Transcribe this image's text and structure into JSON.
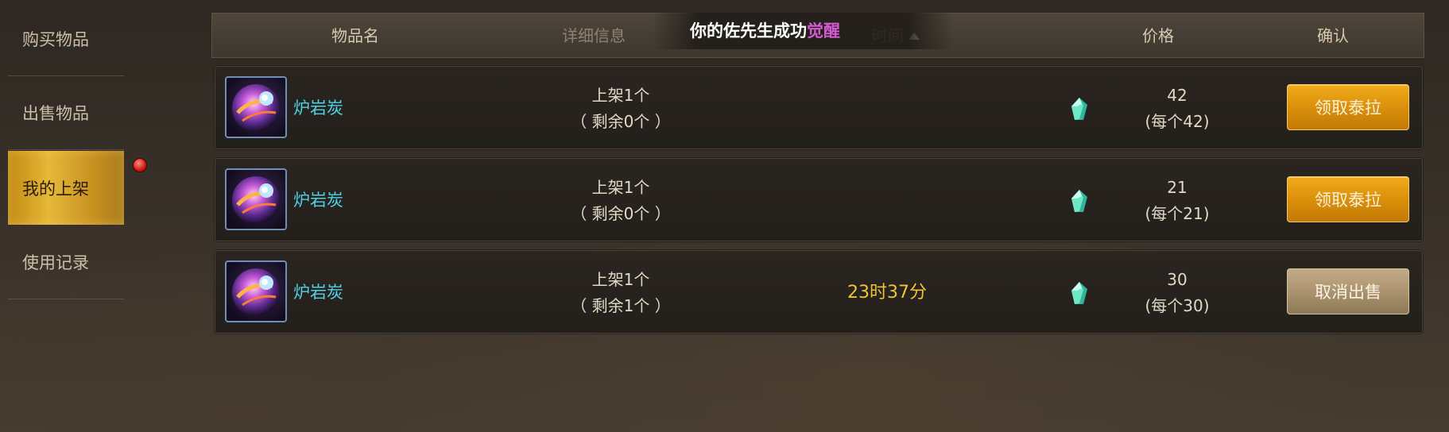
{
  "sidebar": {
    "items": [
      {
        "label": "购买物品",
        "active": false
      },
      {
        "label": "出售物品",
        "active": false
      },
      {
        "label": "我的上架",
        "active": true
      },
      {
        "label": "使用记录",
        "active": false
      }
    ]
  },
  "header": {
    "col_name": "物品名",
    "col_detail": "详细信息",
    "col_time": "时间",
    "col_price": "价格",
    "col_confirm": "确认"
  },
  "notice": {
    "text_before": "你的佐先生成功",
    "highlight": "觉醒"
  },
  "listings": [
    {
      "name": "炉岩炭",
      "listed": "上架1个",
      "remaining": "（ 剩余0个 ）",
      "time": "",
      "price": "42",
      "unit_price": "(每个42)",
      "action": "领取泰拉",
      "action_style": "gold"
    },
    {
      "name": "炉岩炭",
      "listed": "上架1个",
      "remaining": "（ 剩余0个 ）",
      "time": "",
      "price": "21",
      "unit_price": "(每个21)",
      "action": "领取泰拉",
      "action_style": "gold"
    },
    {
      "name": "炉岩炭",
      "listed": "上架1个",
      "remaining": "（ 剩余1个 ）",
      "time": "23时37分",
      "price": "30",
      "unit_price": "(每个30)",
      "action": "取消出售",
      "action_style": "tan"
    }
  ],
  "icons": {
    "item": "lava-charcoal-orb-icon",
    "currency": "green-crystal-icon",
    "notification": "red-dot-badge",
    "sort": "sort-ascending-arrow-icon"
  },
  "colors": {
    "item_name": "#4fd2e6",
    "time": "#f1c232",
    "active_tab": "#e6b838",
    "gold_button": "#d98d0a",
    "tan_button": "#a8916c",
    "notice_highlight": "#d35ad0"
  }
}
